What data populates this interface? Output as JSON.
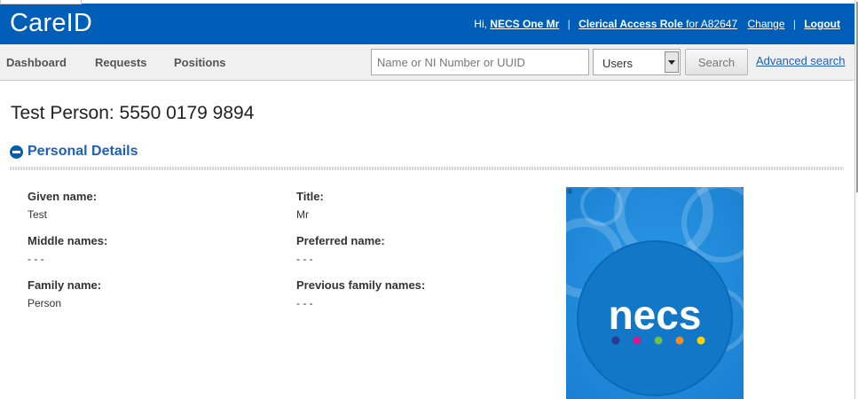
{
  "app": {
    "brand": "CareID"
  },
  "header": {
    "greeting": "Hi,",
    "user_name": "NECS One Mr",
    "role_label": "Clerical Access Role",
    "role_suffix": " for A82647",
    "change_label": "Change",
    "separator": "|",
    "logout_label": "Logout"
  },
  "nav": {
    "items": [
      "Dashboard",
      "Requests",
      "Positions"
    ]
  },
  "search": {
    "placeholder": "Name or NI Number or UUID",
    "type_selected": "Users",
    "button_label": "Search",
    "advanced_label": "Advanced search"
  },
  "page": {
    "title": "Test Person: 5550 0179 9894"
  },
  "section": {
    "title": "Personal Details"
  },
  "fields": [
    {
      "label": "Given name:",
      "value": "Test"
    },
    {
      "label": "Title:",
      "value": "Mr"
    },
    {
      "label": "Middle names:",
      "value": "- - -"
    },
    {
      "label": "Preferred name:",
      "value": "- - -"
    },
    {
      "label": "Family name:",
      "value": "Person"
    },
    {
      "label": "Previous family names:",
      "value": "- - -"
    }
  ],
  "photo": {
    "logo_text": "necs",
    "background": "#1e88d8",
    "dot_colors": [
      "#2a3a8c",
      "#d6168c",
      "#6cc04a",
      "#f28c28",
      "#ffd200"
    ]
  },
  "colors": {
    "header_bg": "#005eb8",
    "link": "#1f5fb8",
    "accent": "#005eb8"
  }
}
